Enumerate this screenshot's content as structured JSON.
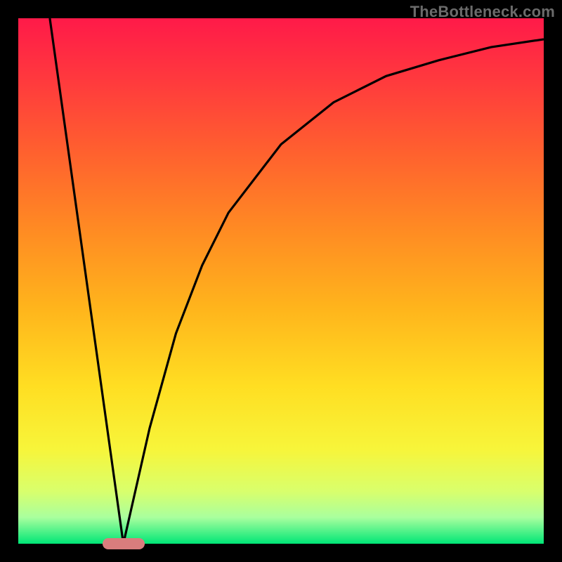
{
  "watermark": "TheBottleneck.com",
  "chart_data": {
    "type": "line",
    "title": "",
    "xlabel": "",
    "ylabel": "",
    "xlim": [
      0,
      1
    ],
    "ylim": [
      0,
      1
    ],
    "grid": false,
    "legend": false,
    "background": "vertical-gradient red→yellow→green",
    "series": [
      {
        "name": "left-linear-drop",
        "x": [
          0.06,
          0.2
        ],
        "y": [
          1.0,
          0.0
        ]
      },
      {
        "name": "right-rising-curve",
        "x": [
          0.2,
          0.25,
          0.3,
          0.35,
          0.4,
          0.5,
          0.6,
          0.7,
          0.8,
          0.9,
          1.0
        ],
        "y": [
          0.0,
          0.22,
          0.4,
          0.53,
          0.63,
          0.76,
          0.84,
          0.89,
          0.92,
          0.945,
          0.96
        ]
      }
    ],
    "marker": {
      "name": "minimum-indicator",
      "x": 0.2,
      "y": 0.0,
      "shape": "rounded-horizontal-bar",
      "color": "#d97d7d"
    }
  }
}
